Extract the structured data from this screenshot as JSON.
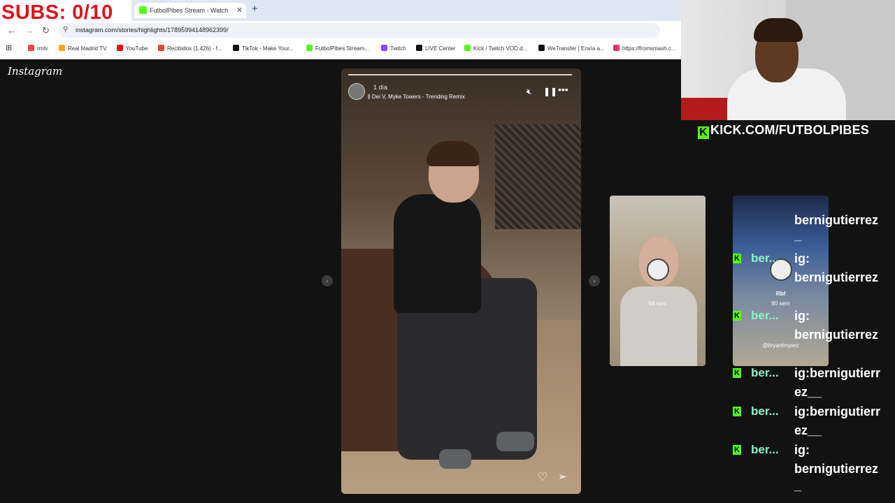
{
  "overlay": {
    "subs_counter": "SUBS: 0/10",
    "kick_url": "KICK.COM/FUTBOLPIBES"
  },
  "browser": {
    "tab_title": "FutbolPibes Stream - Watch Liv",
    "url": "instagram.com/stories/highlights/17895994148962399/",
    "bookmarks": [
      {
        "label": "rmtv",
        "color": "#e3474f"
      },
      {
        "label": "Real Madrid TV",
        "color": "#f5a623"
      },
      {
        "label": "YouTube",
        "color": "#ff0000"
      },
      {
        "label": "Recibidos (1.426) - f...",
        "color": "#ea4335"
      },
      {
        "label": "TikTok - Make Your...",
        "color": "#111111"
      },
      {
        "label": "FutbolPibes Stream...",
        "color": "#53fc18"
      },
      {
        "label": "Twitch",
        "color": "#9146ff"
      },
      {
        "label": "LIVE Center",
        "color": "#111111"
      },
      {
        "label": "Kick / Twitch VOD d...",
        "color": "#53fc18"
      },
      {
        "label": "WeTransfer | Envía a...",
        "color": "#111111"
      },
      {
        "label": "https://fromsmash.c...",
        "color": "#e6336b"
      }
    ]
  },
  "instagram": {
    "logo": "Instagram",
    "story": {
      "time": "1 día",
      "song": "Dei V, Myke Towers - Trending Remix"
    },
    "thumbs": [
      {
        "time": "54 sem"
      },
      {
        "name": "Rbf",
        "time": "80 sem",
        "tag": "@bryantmyerz"
      }
    ]
  },
  "chat": {
    "top_fragment": "bernigutierrez",
    "messages": [
      {
        "user": "ber...",
        "lines": [
          "ig:",
          "bernigutierrez"
        ]
      },
      {
        "user": "ber...",
        "lines": [
          "ig:",
          "bernigutierrez"
        ]
      },
      {
        "user": "ber...",
        "lines": [
          "ig:bernigutierr",
          "ez__"
        ]
      },
      {
        "user": "ber...",
        "lines": [
          "ig:bernigutierr",
          "ez__"
        ]
      },
      {
        "user": "ber...",
        "lines": [
          "ig:",
          "bernigutierrez"
        ]
      }
    ]
  },
  "colors": {
    "kick_green": "#53fc18",
    "subs_red": "#e0121a",
    "chat_user": "#8bf5c8"
  }
}
